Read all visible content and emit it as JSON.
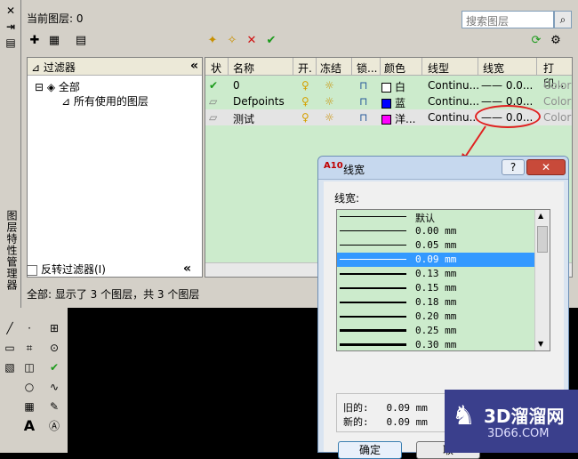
{
  "palette": {
    "close_glyph": "✕",
    "pin_glyph": "⇥",
    "prop_glyph": "▤",
    "title": "图层特性管理器"
  },
  "header": {
    "current_layer": "当前图层: 0",
    "search_placeholder": "搜索图层"
  },
  "filters": {
    "header": "过滤器",
    "collapse": "«",
    "tree": [
      {
        "label": "全部"
      },
      {
        "label": "所有使用的图层"
      }
    ],
    "invert_label": "反转过滤器(I)"
  },
  "grid": {
    "columns": [
      "状",
      "名称",
      "开.",
      "冻结",
      "锁...",
      "颜色",
      "线型",
      "线宽",
      "打印..."
    ],
    "rows": [
      {
        "status": "✔",
        "name": "0",
        "color_name": "白",
        "color": "#ffffff",
        "linetype": "Continu...",
        "lineweight": "—— 0.0...",
        "plot": "Color"
      },
      {
        "status": "▱",
        "name": "Defpoints",
        "color_name": "蓝",
        "color": "#0000ff",
        "linetype": "Continu...",
        "lineweight": "—— 0.0...",
        "plot": "Color"
      },
      {
        "status": "▱",
        "name": "测试",
        "color_name": "洋...",
        "color": "#ff00ff",
        "linetype": "Continu...",
        "lineweight": "—— 0.0...",
        "plot": "Color"
      }
    ]
  },
  "status_text": "全部: 显示了 3 个图层，共 3 个图层",
  "dialog": {
    "title": "线宽",
    "logo": "A10",
    "help": "?",
    "close": "✕",
    "list_label": "线宽:",
    "items": [
      {
        "label": "默认"
      },
      {
        "label": "0.00 mm"
      },
      {
        "label": "0.05 mm"
      },
      {
        "label": "0.09 mm",
        "selected": true
      },
      {
        "label": "0.13 mm"
      },
      {
        "label": "0.15 mm"
      },
      {
        "label": "0.18 mm"
      },
      {
        "label": "0.20 mm"
      },
      {
        "label": "0.25 mm"
      },
      {
        "label": "0.30 mm"
      }
    ],
    "old_label": "旧的:",
    "old_value": "0.09 mm",
    "new_label": "新的:",
    "new_value": "0.09 mm",
    "ok": "确定",
    "cancel": "取"
  },
  "watermark": {
    "name": "3D溜溜网",
    "url": "3D66.COM"
  }
}
